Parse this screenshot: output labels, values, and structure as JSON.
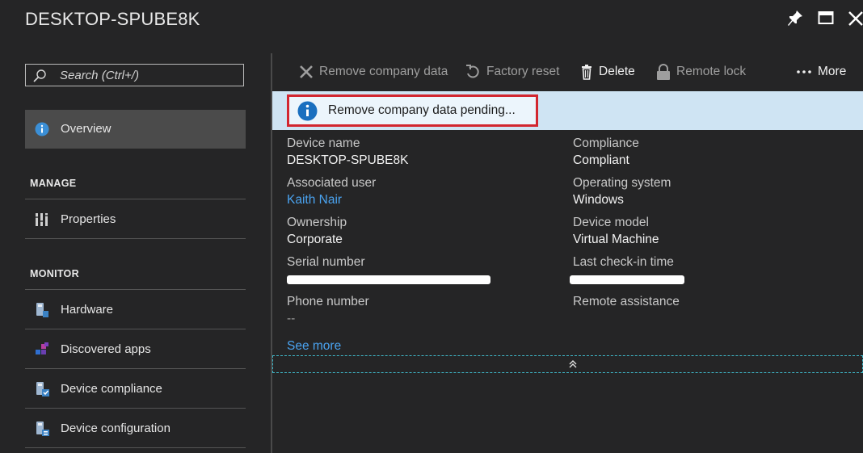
{
  "window": {
    "title": "DESKTOP-SPUBE8K",
    "controls": {
      "pin": "pin-icon",
      "maximize": "maximize-icon",
      "close": "close-icon"
    }
  },
  "sidebar": {
    "search_placeholder": "Search (Ctrl+/)",
    "overview_label": "Overview",
    "manage_heading": "MANAGE",
    "properties_label": "Properties",
    "monitor_heading": "MONITOR",
    "monitor_items": [
      {
        "label": "Hardware",
        "icon": "hardware-icon"
      },
      {
        "label": "Discovered apps",
        "icon": "discovered-apps-icon"
      },
      {
        "label": "Device compliance",
        "icon": "device-compliance-icon"
      },
      {
        "label": "Device configuration",
        "icon": "device-configuration-icon"
      }
    ]
  },
  "toolbar": {
    "remove_company_data": "Remove company data",
    "factory_reset": "Factory reset",
    "delete": "Delete",
    "remote_lock": "Remote lock",
    "more": "More"
  },
  "banner": {
    "text": "Remove company data pending..."
  },
  "properties": {
    "device_name_label": "Device name",
    "device_name_value": "DESKTOP-SPUBE8K",
    "associated_user_label": "Associated user",
    "associated_user_value": "Kaith Nair",
    "ownership_label": "Ownership",
    "ownership_value": "Corporate",
    "serial_number_label": "Serial number",
    "phone_number_label": "Phone number",
    "phone_number_value": "--",
    "compliance_label": "Compliance",
    "compliance_value": "Compliant",
    "os_label": "Operating system",
    "os_value": "Windows",
    "device_model_label": "Device model",
    "device_model_value": "Virtual Machine",
    "last_checkin_label": "Last check-in time",
    "remote_assistance_label": "Remote assistance",
    "see_more": "See more"
  },
  "colors": {
    "background": "#252526",
    "banner": "#cfe4f3",
    "banner_border": "#d2262f",
    "link": "#4aa3f0",
    "info_icon": "#1a6fbf"
  }
}
